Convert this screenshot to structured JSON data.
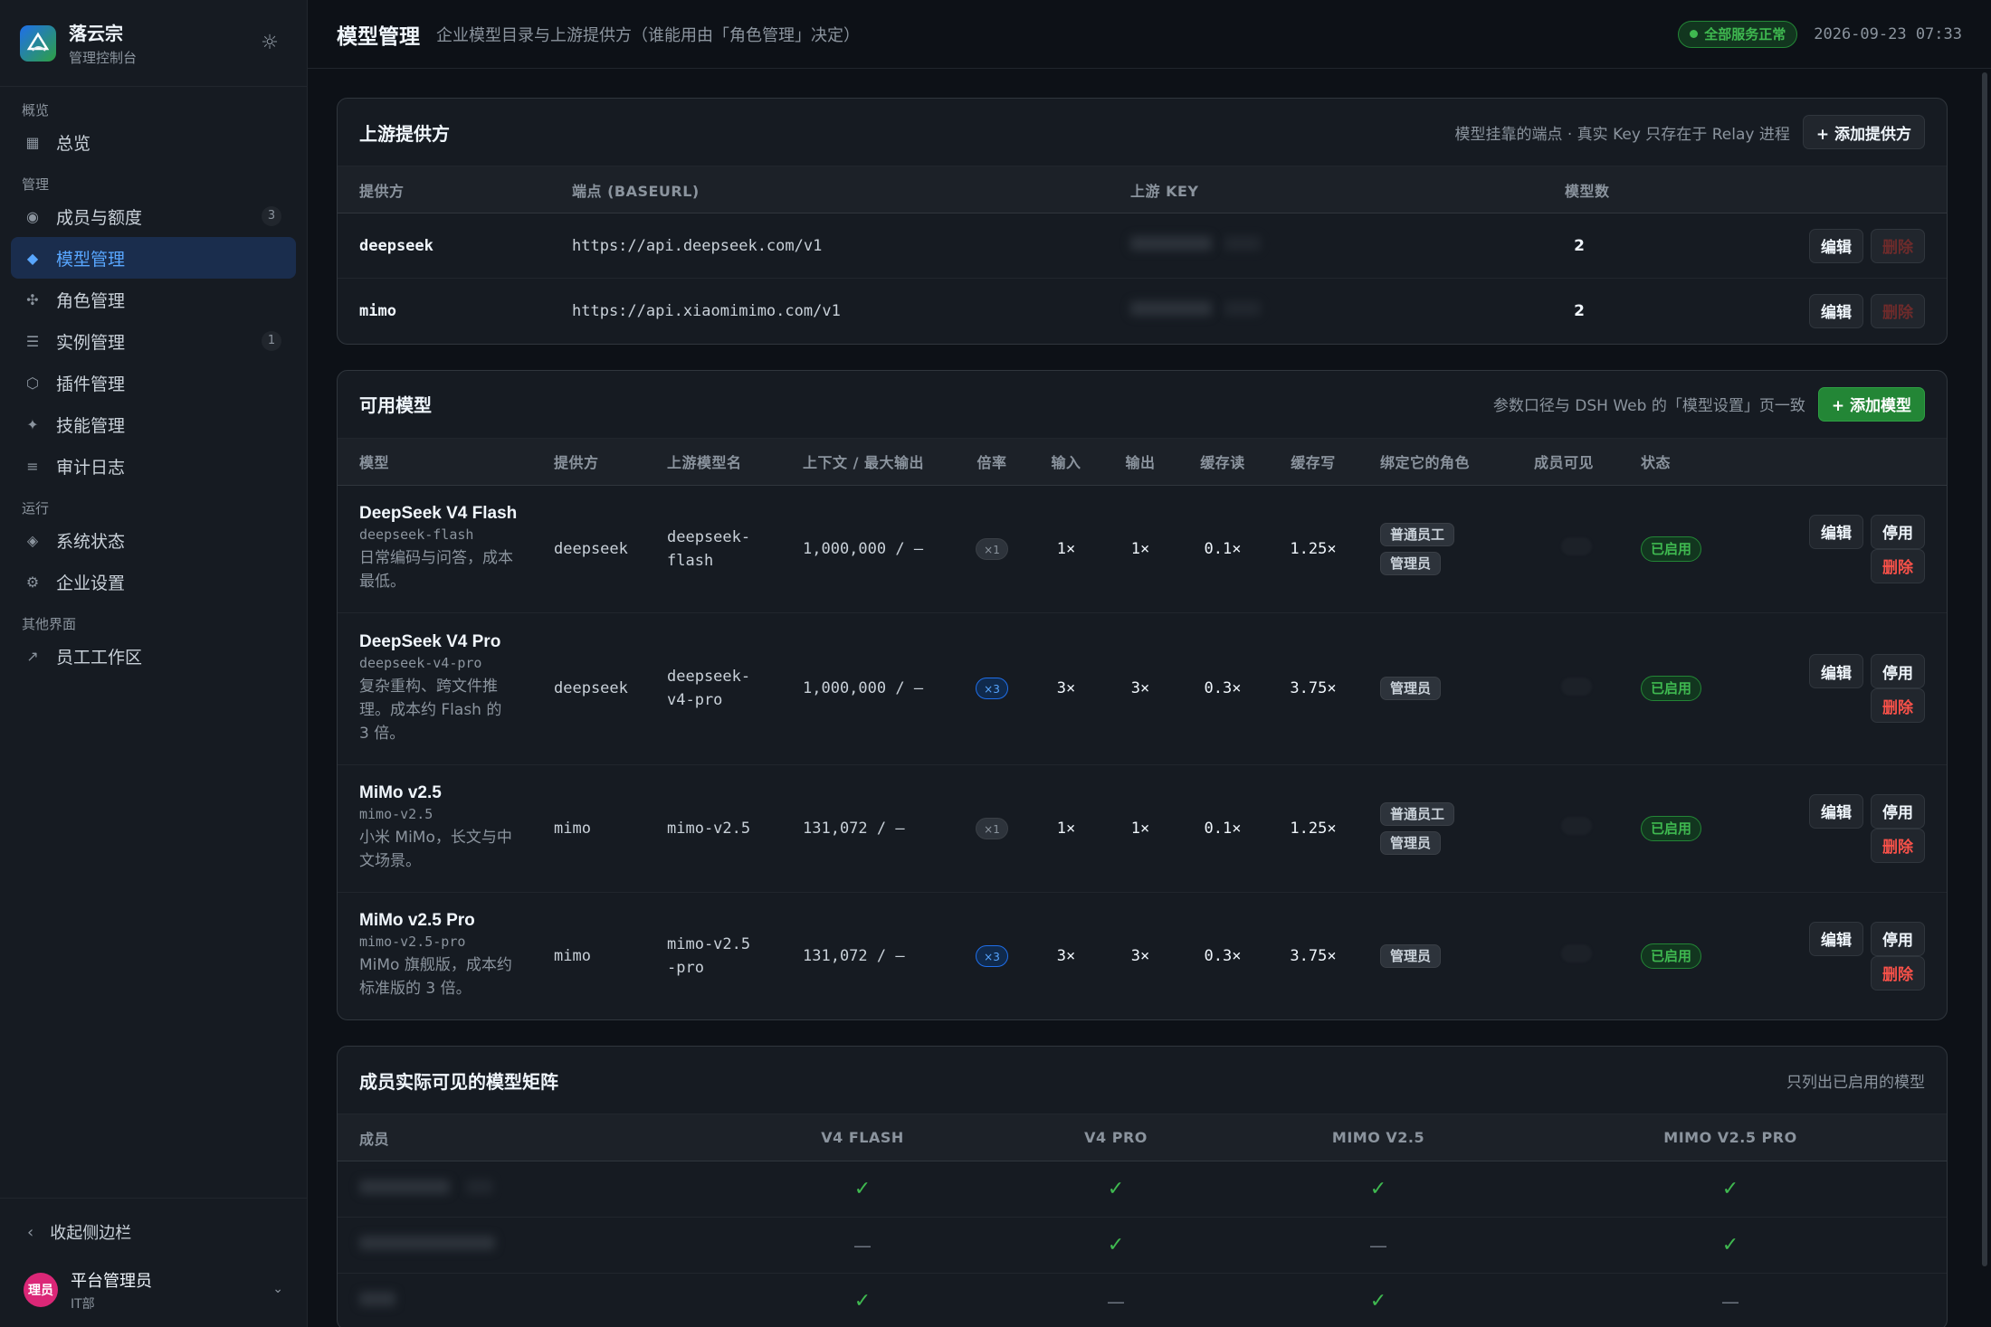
{
  "brand": {
    "name": "落云宗",
    "subtitle": "管理控制台"
  },
  "sidebar": {
    "groups": [
      {
        "label": "概览",
        "items": [
          {
            "label": "总览",
            "icon": "grid-icon"
          }
        ]
      },
      {
        "label": "管理",
        "items": [
          {
            "label": "成员与额度",
            "icon": "circle-icon",
            "badge": "3"
          },
          {
            "label": "模型管理",
            "icon": "diamond-icon",
            "active": true
          },
          {
            "label": "角色管理",
            "icon": "cluster-icon"
          },
          {
            "label": "实例管理",
            "icon": "list-icon",
            "badge": "1"
          },
          {
            "label": "插件管理",
            "icon": "hexagon-icon"
          },
          {
            "label": "技能管理",
            "icon": "sparkle-icon"
          },
          {
            "label": "审计日志",
            "icon": "lines-icon"
          }
        ]
      },
      {
        "label": "运行",
        "items": [
          {
            "label": "系统状态",
            "icon": "diamond-outline-icon"
          },
          {
            "label": "企业设置",
            "icon": "gear-icon"
          }
        ]
      },
      {
        "label": "其他界面",
        "items": [
          {
            "label": "员工工作区",
            "icon": "arrow-icon"
          }
        ]
      }
    ],
    "collapse_label": "收起侧边栏",
    "user": {
      "avatar": "理员",
      "name": "平台管理员",
      "dept": "IT部"
    }
  },
  "header": {
    "title": "模型管理",
    "subtitle": "企业模型目录与上游提供方（谁能用由「角色管理」决定）",
    "status": "全部服务正常",
    "time": "2026-09-23 07:33"
  },
  "providers": {
    "title": "上游提供方",
    "note": "模型挂靠的端点 · 真实 Key 只存在于 Relay 进程",
    "add_label": "+ 添加提供方",
    "columns": [
      "提供方",
      "端点 (BASEURL)",
      "上游 KEY",
      "模型数"
    ],
    "rows": [
      {
        "name": "deepseek",
        "endpoint": "https://api.deepseek.com/v1",
        "count": "2"
      },
      {
        "name": "mimo",
        "endpoint": "https://api.xiaomimimo.com/v1",
        "count": "2"
      }
    ],
    "edit_label": "编辑",
    "delete_label": "删除"
  },
  "models": {
    "title": "可用模型",
    "note": "参数口径与 DSH Web 的「模型设置」页一致",
    "add_label": "+ 添加模型",
    "columns": [
      "模型",
      "提供方",
      "上游模型名",
      "上下文 / 最大输出",
      "倍率",
      "输入",
      "输出",
      "缓存读",
      "缓存写",
      "绑定它的角色",
      "成员可见",
      "状态"
    ],
    "rows": [
      {
        "name": "DeepSeek V4 Flash",
        "id": "deepseek-flash",
        "desc": "日常编码与问答，成本最低。",
        "provider": "deepseek",
        "upstream": "deepseek-flash",
        "context": "1,000,000 / —",
        "rate": "×1",
        "in": "1×",
        "out": "1×",
        "cache_r": "0.1×",
        "cache_w": "1.25×",
        "roles": [
          "普通员工",
          "管理员"
        ],
        "status": "已启用"
      },
      {
        "name": "DeepSeek V4 Pro",
        "id": "deepseek-v4-pro",
        "desc": "复杂重构、跨文件推理。成本约 Flash 的 3 倍。",
        "provider": "deepseek",
        "upstream": "deepseek-v4-pro",
        "context": "1,000,000 / —",
        "rate": "×3",
        "in": "3×",
        "out": "3×",
        "cache_r": "0.3×",
        "cache_w": "3.75×",
        "roles": [
          "管理员"
        ],
        "status": "已启用"
      },
      {
        "name": "MiMo v2.5",
        "id": "mimo-v2.5",
        "desc": "小米 MiMo，长文与中文场景。",
        "provider": "mimo",
        "upstream": "mimo-v2.5",
        "context": "131,072 / —",
        "rate": "×1",
        "in": "1×",
        "out": "1×",
        "cache_r": "0.1×",
        "cache_w": "1.25×",
        "roles": [
          "普通员工",
          "管理员"
        ],
        "status": "已启用"
      },
      {
        "name": "MiMo v2.5 Pro",
        "id": "mimo-v2.5-pro",
        "desc": "MiMo 旗舰版，成本约标准版的 3 倍。",
        "provider": "mimo",
        "upstream": "mimo-v2.5-pro",
        "context": "131,072 / —",
        "rate": "×3",
        "in": "3×",
        "out": "3×",
        "cache_r": "0.3×",
        "cache_w": "3.75×",
        "roles": [
          "管理员"
        ],
        "status": "已启用"
      }
    ],
    "edit_label": "编辑",
    "disable_label": "停用",
    "delete_label": "删除"
  },
  "matrix": {
    "title": "成员实际可见的模型矩阵",
    "note": "只列出已启用的模型",
    "columns": [
      "成员",
      "V4 FLASH",
      "V4 PRO",
      "MIMO V2.5",
      "MIMO V2.5 PRO"
    ],
    "rows": [
      {
        "cells": [
          "✓",
          "✓",
          "✓",
          "✓"
        ]
      },
      {
        "cells": [
          "—",
          "✓",
          "—",
          "✓"
        ]
      },
      {
        "cells": [
          "✓",
          "—",
          "✓",
          "—"
        ]
      }
    ]
  },
  "colors": {
    "accent": "#58a6ff",
    "success": "#3fb950",
    "danger": "#f85149",
    "bg": "#0d1117"
  }
}
